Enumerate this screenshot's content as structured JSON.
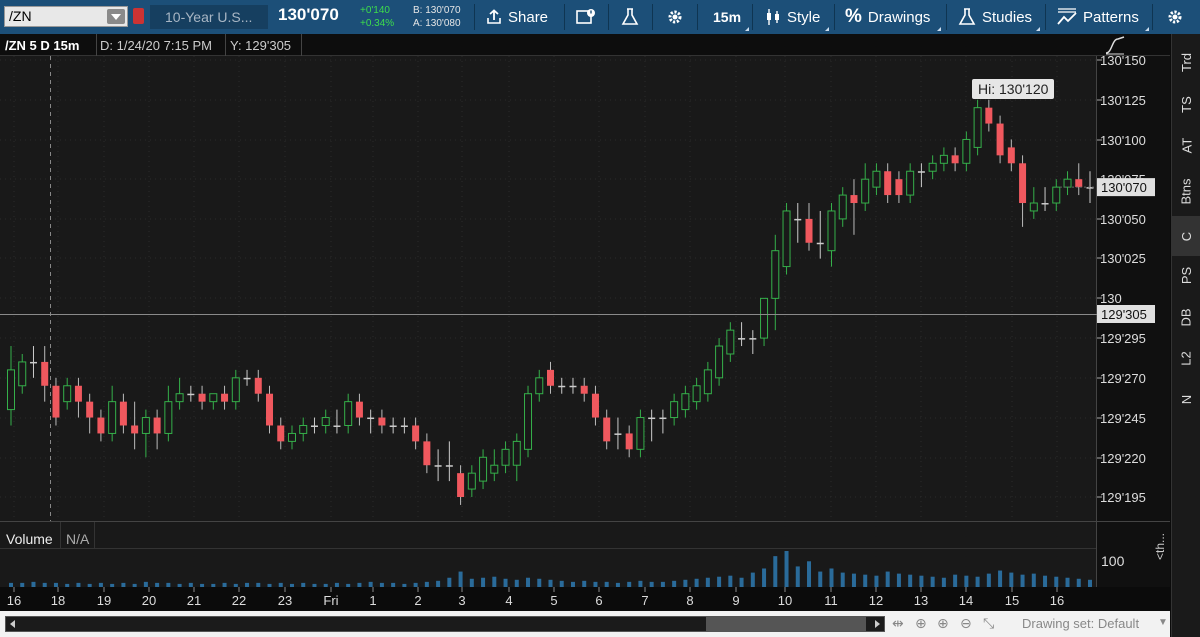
{
  "toolbar": {
    "symbol": "/ZN",
    "description": "10-Year U.S...",
    "last_price": "130'070",
    "net_change": "+0'140",
    "pct_change": "+0.34%",
    "bid": "B: 130'070",
    "ask": "A: 130'080",
    "share_label": "Share",
    "aggregation": "15m",
    "style_label": "Style",
    "drawings_label": "Drawings",
    "studies_label": "Studies",
    "patterns_label": "Patterns",
    "icons": [
      "share-icon",
      "news-icon",
      "flask-icon",
      "gear-icon",
      "candle-icon",
      "percent-icon",
      "studies-flask-icon",
      "patterns-icon",
      "settings-icon"
    ]
  },
  "infobar": {
    "title": "/ZN 5 D 15m",
    "date": "D: 1/24/20 7:15 PM",
    "y_value": "Y: 129'305"
  },
  "volume_panel": {
    "label": "Volume",
    "value": "N/A",
    "axis_label": "100",
    "study_label": "<th..."
  },
  "side_tabs": [
    "Trd",
    "TS",
    "AT",
    "Btns",
    "C",
    "PS",
    "DB",
    "L2",
    "N"
  ],
  "side_active": "C",
  "bottom": {
    "drawing_set": "Drawing set: Default"
  },
  "colors": {
    "up": "#35b04a",
    "down": "#f0585e",
    "flat": "#cccccc",
    "volume": "#2a6b9a",
    "toolbar": "#1c4f78"
  },
  "chart_data": {
    "type": "candlestick",
    "price_axis_ticks": [
      "130'150",
      "130'125",
      "130'100",
      "130'075",
      "130'050",
      "130'025",
      "130",
      "129'295",
      "129'270",
      "129'245",
      "129'220",
      "129'195"
    ],
    "current_price_label": "130'070",
    "crosshair_price_label": "129'305",
    "high_label": "Hi: 130'120",
    "time_axis_labels": [
      "16",
      "18",
      "19",
      "20",
      "21",
      "22",
      "23",
      "Fri",
      "1",
      "2",
      "3",
      "4",
      "5",
      "6",
      "7",
      "8",
      "9",
      "10",
      "11",
      "12",
      "13",
      "14",
      "15",
      "16"
    ],
    "price_range": [
      129.18,
      130.16
    ],
    "candles": [
      {
        "o": 129.25,
        "h": 129.29,
        "l": 129.24,
        "c": 129.275
      },
      {
        "o": 129.265,
        "h": 129.285,
        "l": 129.26,
        "c": 129.28
      },
      {
        "o": 129.28,
        "h": 129.29,
        "l": 129.27,
        "c": 129.28
      },
      {
        "o": 129.28,
        "h": 129.29,
        "l": 129.255,
        "c": 129.265
      },
      {
        "o": 129.265,
        "h": 129.27,
        "l": 129.24,
        "c": 129.245
      },
      {
        "o": 129.255,
        "h": 129.27,
        "l": 129.25,
        "c": 129.265
      },
      {
        "o": 129.265,
        "h": 129.27,
        "l": 129.245,
        "c": 129.255
      },
      {
        "o": 129.255,
        "h": 129.26,
        "l": 129.235,
        "c": 129.245
      },
      {
        "o": 129.245,
        "h": 129.25,
        "l": 129.23,
        "c": 129.235
      },
      {
        "o": 129.235,
        "h": 129.265,
        "l": 129.23,
        "c": 129.255
      },
      {
        "o": 129.255,
        "h": 129.26,
        "l": 129.235,
        "c": 129.24
      },
      {
        "o": 129.24,
        "h": 129.255,
        "l": 129.225,
        "c": 129.235
      },
      {
        "o": 129.235,
        "h": 129.25,
        "l": 129.22,
        "c": 129.245
      },
      {
        "o": 129.245,
        "h": 129.25,
        "l": 129.225,
        "c": 129.235
      },
      {
        "o": 129.235,
        "h": 129.265,
        "l": 129.23,
        "c": 129.255
      },
      {
        "o": 129.255,
        "h": 129.27,
        "l": 129.25,
        "c": 129.26
      },
      {
        "o": 129.26,
        "h": 129.265,
        "l": 129.255,
        "c": 129.26
      },
      {
        "o": 129.26,
        "h": 129.265,
        "l": 129.25,
        "c": 129.255
      },
      {
        "o": 129.255,
        "h": 129.26,
        "l": 129.25,
        "c": 129.26
      },
      {
        "o": 129.26,
        "h": 129.265,
        "l": 129.25,
        "c": 129.255
      },
      {
        "o": 129.255,
        "h": 129.275,
        "l": 129.25,
        "c": 129.27
      },
      {
        "o": 129.27,
        "h": 129.275,
        "l": 129.265,
        "c": 129.27
      },
      {
        "o": 129.27,
        "h": 129.275,
        "l": 129.255,
        "c": 129.26
      },
      {
        "o": 129.26,
        "h": 129.265,
        "l": 129.235,
        "c": 129.24
      },
      {
        "o": 129.24,
        "h": 129.245,
        "l": 129.225,
        "c": 129.23
      },
      {
        "o": 129.23,
        "h": 129.24,
        "l": 129.225,
        "c": 129.235
      },
      {
        "o": 129.235,
        "h": 129.245,
        "l": 129.23,
        "c": 129.24
      },
      {
        "o": 129.24,
        "h": 129.245,
        "l": 129.235,
        "c": 129.24
      },
      {
        "o": 129.24,
        "h": 129.25,
        "l": 129.235,
        "c": 129.245
      },
      {
        "o": 129.24,
        "h": 129.25,
        "l": 129.235,
        "c": 129.24
      },
      {
        "o": 129.24,
        "h": 129.26,
        "l": 129.235,
        "c": 129.255
      },
      {
        "o": 129.255,
        "h": 129.26,
        "l": 129.24,
        "c": 129.245
      },
      {
        "o": 129.245,
        "h": 129.25,
        "l": 129.235,
        "c": 129.245
      },
      {
        "o": 129.245,
        "h": 129.25,
        "l": 129.235,
        "c": 129.24
      },
      {
        "o": 129.24,
        "h": 129.245,
        "l": 129.235,
        "c": 129.24
      },
      {
        "o": 129.24,
        "h": 129.245,
        "l": 129.235,
        "c": 129.24
      },
      {
        "o": 129.24,
        "h": 129.245,
        "l": 129.225,
        "c": 129.23
      },
      {
        "o": 129.23,
        "h": 129.235,
        "l": 129.21,
        "c": 129.215
      },
      {
        "o": 129.215,
        "h": 129.225,
        "l": 129.205,
        "c": 129.215
      },
      {
        "o": 129.215,
        "h": 129.23,
        "l": 129.205,
        "c": 129.215
      },
      {
        "o": 129.21,
        "h": 129.215,
        "l": 129.19,
        "c": 129.195
      },
      {
        "o": 129.2,
        "h": 129.215,
        "l": 129.195,
        "c": 129.21
      },
      {
        "o": 129.205,
        "h": 129.225,
        "l": 129.2,
        "c": 129.22
      },
      {
        "o": 129.21,
        "h": 129.225,
        "l": 129.205,
        "c": 129.215
      },
      {
        "o": 129.215,
        "h": 129.23,
        "l": 129.21,
        "c": 129.225
      },
      {
        "o": 129.215,
        "h": 129.235,
        "l": 129.205,
        "c": 129.23
      },
      {
        "o": 129.225,
        "h": 129.265,
        "l": 129.22,
        "c": 129.26
      },
      {
        "o": 129.26,
        "h": 129.275,
        "l": 129.255,
        "c": 129.27
      },
      {
        "o": 129.275,
        "h": 129.28,
        "l": 129.26,
        "c": 129.265
      },
      {
        "o": 129.265,
        "h": 129.27,
        "l": 129.26,
        "c": 129.265
      },
      {
        "o": 129.265,
        "h": 129.27,
        "l": 129.26,
        "c": 129.265
      },
      {
        "o": 129.265,
        "h": 129.27,
        "l": 129.255,
        "c": 129.26
      },
      {
        "o": 129.26,
        "h": 129.265,
        "l": 129.24,
        "c": 129.245
      },
      {
        "o": 129.245,
        "h": 129.25,
        "l": 129.225,
        "c": 129.23
      },
      {
        "o": 129.235,
        "h": 129.245,
        "l": 129.225,
        "c": 129.235
      },
      {
        "o": 129.235,
        "h": 129.24,
        "l": 129.22,
        "c": 129.225
      },
      {
        "o": 129.225,
        "h": 129.25,
        "l": 129.22,
        "c": 129.245
      },
      {
        "o": 129.245,
        "h": 129.25,
        "l": 129.23,
        "c": 129.245
      },
      {
        "o": 129.245,
        "h": 129.25,
        "l": 129.235,
        "c": 129.245
      },
      {
        "o": 129.245,
        "h": 129.26,
        "l": 129.24,
        "c": 129.255
      },
      {
        "o": 129.25,
        "h": 129.265,
        "l": 129.245,
        "c": 129.26
      },
      {
        "o": 129.255,
        "h": 129.27,
        "l": 129.25,
        "c": 129.265
      },
      {
        "o": 129.26,
        "h": 129.28,
        "l": 129.255,
        "c": 129.275
      },
      {
        "o": 129.27,
        "h": 129.295,
        "l": 129.265,
        "c": 129.29
      },
      {
        "o": 129.285,
        "h": 129.305,
        "l": 129.28,
        "c": 129.3
      },
      {
        "o": 129.295,
        "h": 129.305,
        "l": 129.29,
        "c": 129.295
      },
      {
        "o": 129.295,
        "h": 129.3,
        "l": 129.285,
        "c": 129.295
      },
      {
        "o": 129.295,
        "h": 129.32,
        "l": 129.29,
        "c": 130.0
      },
      {
        "o": 130.0,
        "h": 130.04,
        "l": 129.3,
        "c": 130.03
      },
      {
        "o": 130.02,
        "h": 130.06,
        "l": 130.015,
        "c": 130.055
      },
      {
        "o": 130.05,
        "h": 130.06,
        "l": 130.035,
        "c": 130.05
      },
      {
        "o": 130.05,
        "h": 130.06,
        "l": 130.03,
        "c": 130.035
      },
      {
        "o": 130.035,
        "h": 130.055,
        "l": 130.025,
        "c": 130.035
      },
      {
        "o": 130.03,
        "h": 130.06,
        "l": 130.02,
        "c": 130.055
      },
      {
        "o": 130.05,
        "h": 130.07,
        "l": 130.045,
        "c": 130.065
      },
      {
        "o": 130.065,
        "h": 130.075,
        "l": 130.04,
        "c": 130.06
      },
      {
        "o": 130.06,
        "h": 130.085,
        "l": 130.055,
        "c": 130.075
      },
      {
        "o": 130.07,
        "h": 130.085,
        "l": 130.065,
        "c": 130.08
      },
      {
        "o": 130.08,
        "h": 130.085,
        "l": 130.06,
        "c": 130.065
      },
      {
        "o": 130.075,
        "h": 130.08,
        "l": 130.06,
        "c": 130.065
      },
      {
        "o": 130.065,
        "h": 130.085,
        "l": 130.06,
        "c": 130.08
      },
      {
        "o": 130.08,
        "h": 130.085,
        "l": 130.07,
        "c": 130.08
      },
      {
        "o": 130.08,
        "h": 130.09,
        "l": 130.075,
        "c": 130.085
      },
      {
        "o": 130.085,
        "h": 130.095,
        "l": 130.08,
        "c": 130.09
      },
      {
        "o": 130.09,
        "h": 130.095,
        "l": 130.08,
        "c": 130.085
      },
      {
        "o": 130.085,
        "h": 130.105,
        "l": 130.08,
        "c": 130.1
      },
      {
        "o": 130.095,
        "h": 130.125,
        "l": 130.09,
        "c": 130.12
      },
      {
        "o": 130.12,
        "h": 130.125,
        "l": 130.105,
        "c": 130.11
      },
      {
        "o": 130.11,
        "h": 130.115,
        "l": 130.085,
        "c": 130.09
      },
      {
        "o": 130.095,
        "h": 130.1,
        "l": 130.08,
        "c": 130.085
      },
      {
        "o": 130.085,
        "h": 130.09,
        "l": 130.045,
        "c": 130.06
      },
      {
        "o": 130.055,
        "h": 130.07,
        "l": 130.05,
        "c": 130.06
      },
      {
        "o": 130.06,
        "h": 130.07,
        "l": 130.055,
        "c": 130.06
      },
      {
        "o": 130.06,
        "h": 130.075,
        "l": 130.055,
        "c": 130.07
      },
      {
        "o": 130.07,
        "h": 130.08,
        "l": 130.065,
        "c": 130.075
      },
      {
        "o": 130.075,
        "h": 130.085,
        "l": 130.065,
        "c": 130.07
      },
      {
        "o": 130.07,
        "h": 130.08,
        "l": 130.06,
        "c": 130.07
      }
    ],
    "volume": [
      4,
      4,
      5,
      4,
      4,
      3,
      4,
      3,
      4,
      3,
      4,
      3,
      5,
      4,
      4,
      3,
      4,
      3,
      3,
      4,
      3,
      4,
      4,
      3,
      4,
      3,
      4,
      3,
      3,
      4,
      3,
      4,
      5,
      4,
      4,
      3,
      4,
      5,
      6,
      9,
      15,
      8,
      9,
      10,
      8,
      7,
      9,
      8,
      7,
      6,
      5,
      6,
      5,
      5,
      4,
      5,
      6,
      5,
      5,
      6,
      7,
      8,
      9,
      10,
      11,
      9,
      14,
      18,
      30,
      35,
      20,
      25,
      15,
      18,
      14,
      13,
      12,
      11,
      15,
      13,
      12,
      11,
      10,
      9,
      12,
      11,
      10,
      13,
      16,
      14,
      12,
      13,
      11,
      10,
      9,
      8,
      7,
      6,
      5
    ]
  }
}
